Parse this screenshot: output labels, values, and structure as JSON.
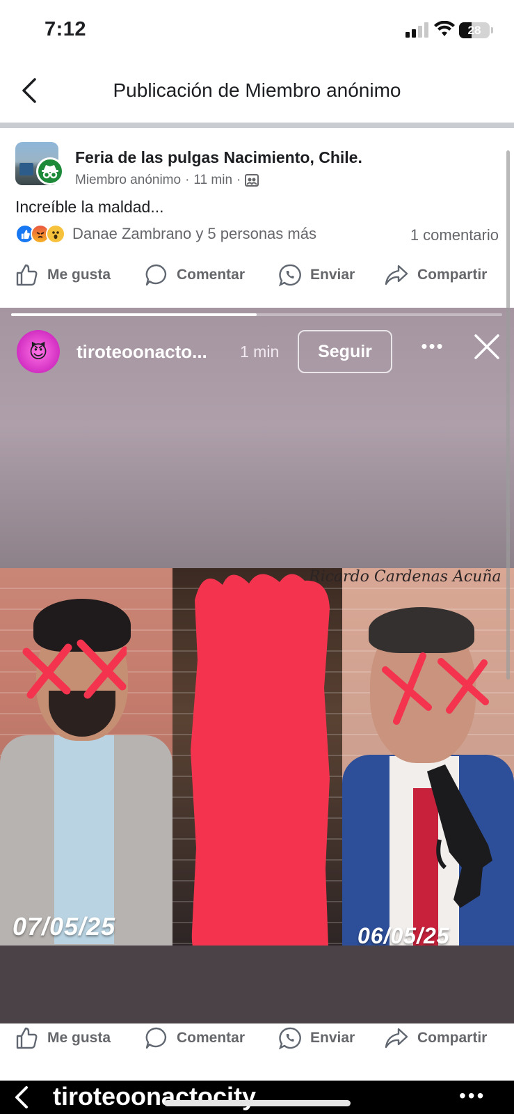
{
  "status_bar": {
    "time": "7:12",
    "battery": "28"
  },
  "header": {
    "title": "Publicación de Miembro anónimo"
  },
  "post": {
    "group_name": "Feria de las pulgas Nacimiento, Chile.",
    "author": "Miembro anónimo",
    "time": "11 min",
    "text": "Increíble la maldad...",
    "reactions_text": "Danae Zambrano y 5 personas más",
    "comments": "1 comentario",
    "actions": {
      "like": "Me gusta",
      "comment": "Comentar",
      "send": "Enviar",
      "share": "Compartir"
    }
  },
  "story": {
    "username": "tiroteoonacto...",
    "time": "1 min",
    "follow": "Seguir",
    "progress": 0.5,
    "watermark": "Ricardo Cardenas Acuña",
    "date_left": "07/05/25",
    "date_right": "06/05/25"
  },
  "bottom_actions": {
    "like": "Me gusta",
    "comment": "Comentar",
    "send": "Enviar",
    "share": "Compartir"
  },
  "bottom_strip": {
    "name": "tiroteoonactocity"
  },
  "colors": {
    "accent_blue": "#1877f2",
    "anon_green": "#1d8a3a",
    "story_bg": "#a999a5",
    "marker_red": "#f4334e"
  }
}
